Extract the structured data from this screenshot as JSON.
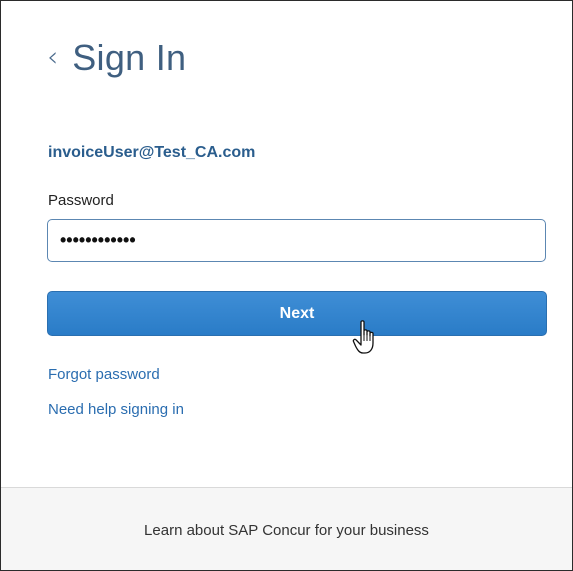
{
  "header": {
    "back_icon": "chevron-left-icon",
    "back_glyph": "‹",
    "title": "Sign In"
  },
  "form": {
    "email": "invoiceUser@Test_CA.com",
    "password_label": "Password",
    "password_value": "••••••••••••",
    "next_label": "Next"
  },
  "links": {
    "forgot_password": "Forgot password",
    "need_help": "Need help signing in"
  },
  "footer": {
    "learn_more": "Learn about SAP Concur for your business"
  },
  "colors": {
    "primary_button": "#2f84cf",
    "link": "#2a6db0",
    "email": "#2a5d8d",
    "title": "#3f5f80"
  }
}
